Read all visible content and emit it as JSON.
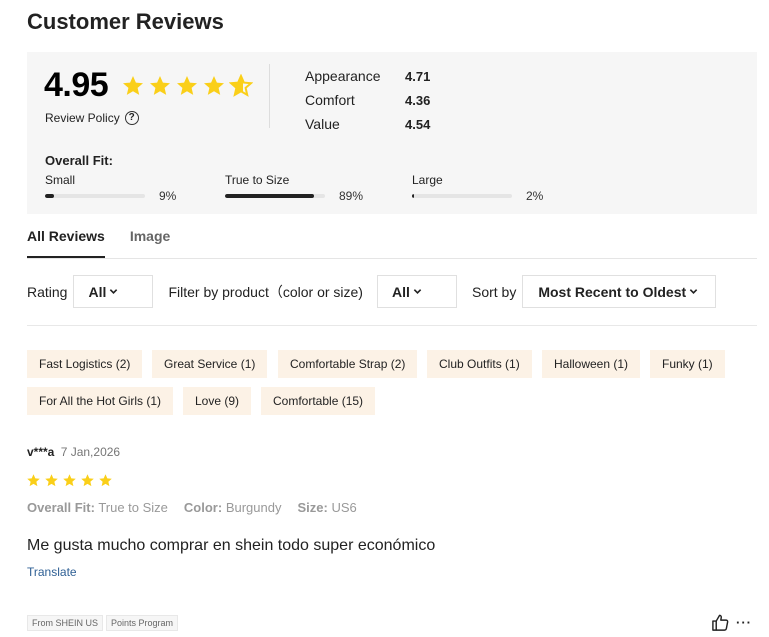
{
  "page": {
    "title": "Customer Reviews"
  },
  "summary": {
    "rating": "4.95",
    "stars": 4.95,
    "policy_label": "Review Policy",
    "policy_icon": "question-circle-icon",
    "sub_ratings": [
      {
        "label": "Appearance",
        "value": "4.71"
      },
      {
        "label": "Comfort",
        "value": "4.36"
      },
      {
        "label": "Value",
        "value": "4.54"
      }
    ],
    "fit": {
      "title": "Overall Fit:",
      "items": [
        {
          "label": "Small",
          "percent": "9%",
          "fraction": 0.09
        },
        {
          "label": "True to Size",
          "percent": "89%",
          "fraction": 0.89
        },
        {
          "label": "Large",
          "percent": "2%",
          "fraction": 0.02
        }
      ]
    }
  },
  "tabs": [
    {
      "label": "All Reviews",
      "active": true
    },
    {
      "label": "Image",
      "active": false
    }
  ],
  "filters": {
    "rating_label": "Rating",
    "rating_value": "All",
    "product_label": "Filter by product（color or size)",
    "product_value": "All",
    "sort_label": "Sort by",
    "sort_value": "Most Recent to Oldest"
  },
  "tags": [
    "Fast Logistics (2)",
    "Great Service (1)",
    "Comfortable Strap (2)",
    "Club Outfits (1)",
    "Halloween (1)",
    "Funky (1)",
    "For All the Hot Girls (1)",
    "Love (9)",
    "Comfortable (15)"
  ],
  "review": {
    "user": "v***a",
    "date": "7 Jan,2026",
    "stars": 5,
    "fit_label": "Overall Fit:",
    "fit_value": "True to Size",
    "color_label": "Color:",
    "color_value": "Burgundy",
    "size_label": "Size:",
    "size_value": "US6",
    "text": "Me gusta mucho comprar en shein todo super económico",
    "translate": "Translate",
    "badges": [
      "From SHEIN US",
      "Points Program"
    ],
    "more": "···"
  },
  "colors": {
    "star": "#facf19",
    "tag_bg": "#fcf2e6",
    "link": "#2e5f94"
  }
}
